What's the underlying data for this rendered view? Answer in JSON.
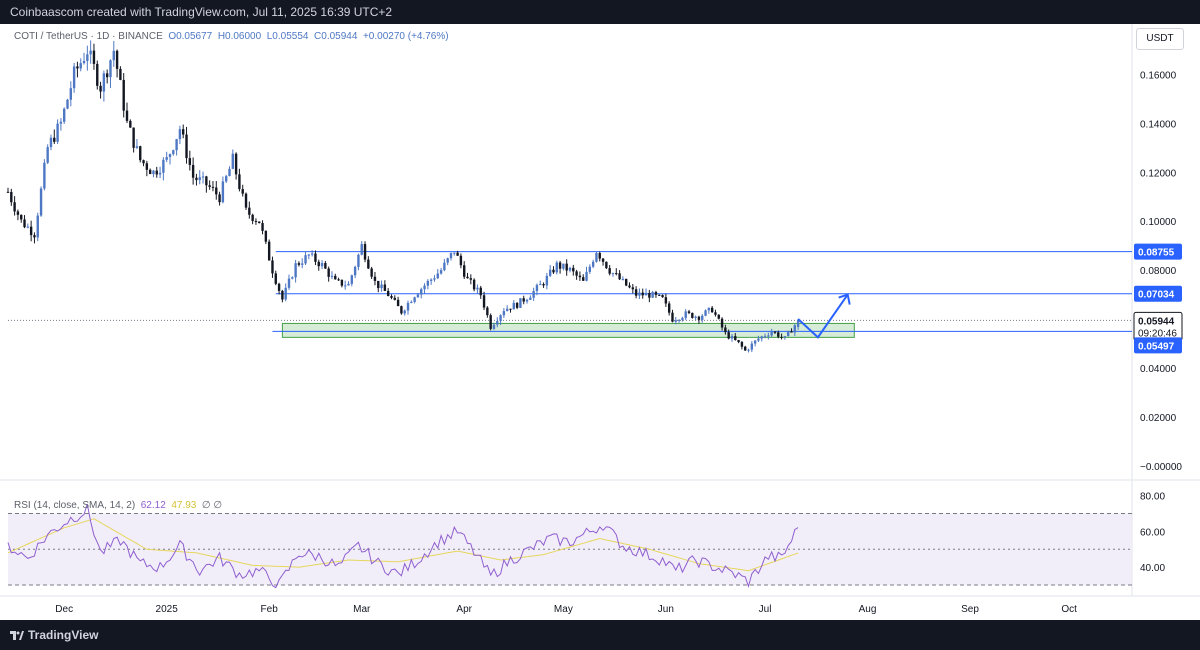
{
  "header": {
    "text": "Coinbaascom created with TradingView.com, Jul 11, 2025 16:39 UTC+2"
  },
  "legend": {
    "symbol": "COTI / TetherUS · 1D · BINANCE",
    "open": "O0.05677",
    "high": "H0.06000",
    "low": "L0.05554",
    "close": "C0.05944",
    "change": "+0.00270 (+4.76%)"
  },
  "price_axis": {
    "unit": "USDT",
    "ticks": [
      "0.16000",
      "0.14000",
      "0.12000",
      "0.10000",
      "0.08000",
      "0.04000",
      "0.02000",
      "−0.00000"
    ]
  },
  "price_labels": {
    "resistance": "0.08755",
    "target": "0.07034",
    "current": "0.05944",
    "countdown": "09:20:46",
    "support": "0.05497"
  },
  "rsi_legend": {
    "title": "RSI (14, close, SMA, 14, 2)",
    "rsi_value": "62.12",
    "ma_value": "47.93",
    "extra": "∅  ∅"
  },
  "rsi_axis": {
    "ticks": [
      "80.00",
      "60.00",
      "40.00"
    ]
  },
  "time_axis": {
    "ticks": [
      "Dec",
      "2025",
      "Feb",
      "Mar",
      "Apr",
      "May",
      "Jun",
      "Jul",
      "Aug",
      "Sep",
      "Oct"
    ]
  },
  "footer": {
    "brand": "TradingView"
  },
  "colors": {
    "bull": "#4e78c4",
    "bear": "#131722",
    "level_line": "#2962ff",
    "zone_fill": "#c8e6c9",
    "rsi_line": "#8f5fd0",
    "rsi_ma": "#e6d65c",
    "rsi_band": "#ede7f6"
  },
  "chart_data": [
    {
      "type": "candlestick",
      "symbol": "COTI / TetherUS",
      "exchange": "BINANCE",
      "ylim": [
        -0.0001,
        0.17
      ],
      "x_range": [
        "2024-11-14",
        "2025-10-20"
      ],
      "ohlc": {
        "open": 0.05677,
        "high": 0.06,
        "low": 0.05554,
        "close": 0.05944,
        "change": 0.0027,
        "change_pct": 4.76
      },
      "close_path": [
        [
          "2024-11-14",
          0.112
        ],
        [
          "2024-11-18",
          0.1
        ],
        [
          "2024-11-22",
          0.095
        ],
        [
          "2024-11-26",
          0.13
        ],
        [
          "2024-11-30",
          0.14
        ],
        [
          "2024-12-04",
          0.16
        ],
        [
          "2024-12-08",
          0.17
        ],
        [
          "2024-12-12",
          0.155
        ],
        [
          "2024-12-16",
          0.17
        ],
        [
          "2024-12-20",
          0.14
        ],
        [
          "2024-12-24",
          0.125
        ],
        [
          "2024-12-28",
          0.12
        ],
        [
          "2025-01-01",
          0.125
        ],
        [
          "2025-01-05",
          0.138
        ],
        [
          "2025-01-09",
          0.118
        ],
        [
          "2025-01-13",
          0.115
        ],
        [
          "2025-01-17",
          0.11
        ],
        [
          "2025-01-21",
          0.125
        ],
        [
          "2025-01-25",
          0.104
        ],
        [
          "2025-01-29",
          0.1
        ],
        [
          "2025-02-02",
          0.08
        ],
        [
          "2025-02-05",
          0.068
        ],
        [
          "2025-02-09",
          0.082
        ],
        [
          "2025-02-13",
          0.086
        ],
        [
          "2025-02-17",
          0.082
        ],
        [
          "2025-02-21",
          0.075
        ],
        [
          "2025-02-25",
          0.074
        ],
        [
          "2025-03-01",
          0.09
        ],
        [
          "2025-03-05",
          0.075
        ],
        [
          "2025-03-09",
          0.07
        ],
        [
          "2025-03-13",
          0.063
        ],
        [
          "2025-03-17",
          0.07
        ],
        [
          "2025-03-21",
          0.075
        ],
        [
          "2025-03-25",
          0.08
        ],
        [
          "2025-03-29",
          0.088
        ],
        [
          "2025-04-02",
          0.076
        ],
        [
          "2025-04-06",
          0.07
        ],
        [
          "2025-04-09",
          0.057
        ],
        [
          "2025-04-13",
          0.064
        ],
        [
          "2025-04-17",
          0.066
        ],
        [
          "2025-04-21",
          0.07
        ],
        [
          "2025-04-25",
          0.075
        ],
        [
          "2025-04-29",
          0.082
        ],
        [
          "2025-05-03",
          0.08
        ],
        [
          "2025-05-07",
          0.075
        ],
        [
          "2025-05-11",
          0.088
        ],
        [
          "2025-05-15",
          0.08
        ],
        [
          "2025-05-19",
          0.075
        ],
        [
          "2025-05-23",
          0.07
        ],
        [
          "2025-05-27",
          0.07
        ],
        [
          "2025-05-31",
          0.068
        ],
        [
          "2025-06-03",
          0.06
        ],
        [
          "2025-06-07",
          0.062
        ],
        [
          "2025-06-11",
          0.061
        ],
        [
          "2025-06-15",
          0.064
        ],
        [
          "2025-06-19",
          0.054
        ],
        [
          "2025-06-23",
          0.05
        ],
        [
          "2025-06-25",
          0.047
        ],
        [
          "2025-06-29",
          0.052
        ],
        [
          "2025-07-03",
          0.055
        ],
        [
          "2025-07-07",
          0.052
        ],
        [
          "2025-07-11",
          0.0594
        ]
      ],
      "horizontal_levels": [
        0.08755,
        0.07034,
        0.05497
      ],
      "current_price": 0.05944,
      "zone": {
        "from": "2025-02-05",
        "to": "2025-07-28",
        "low": 0.0525,
        "high": 0.0582
      },
      "projection": [
        [
          "2025-07-11",
          0.06
        ],
        [
          "2025-07-17",
          0.0525
        ],
        [
          "2025-07-26",
          0.07
        ]
      ]
    },
    {
      "type": "line",
      "title": "RSI (14, close, SMA, 14, 2)",
      "ylim": [
        25,
        82
      ],
      "bands": [
        70,
        50,
        30
      ],
      "series": [
        {
          "name": "RSI",
          "points": [
            [
              "2024-11-14",
              52
            ],
            [
              "2024-11-20",
              45
            ],
            [
              "2024-11-26",
              58
            ],
            [
              "2024-12-02",
              66
            ],
            [
              "2024-12-08",
              72
            ],
            [
              "2024-12-12",
              48
            ],
            [
              "2024-12-18",
              55
            ],
            [
              "2024-12-24",
              42
            ],
            [
              "2024-12-30",
              40
            ],
            [
              "2025-01-05",
              52
            ],
            [
              "2025-01-11",
              38
            ],
            [
              "2025-01-17",
              45
            ],
            [
              "2025-01-23",
              36
            ],
            [
              "2025-01-29",
              38
            ],
            [
              "2025-02-04",
              30
            ],
            [
              "2025-02-10",
              48
            ],
            [
              "2025-02-16",
              46
            ],
            [
              "2025-02-22",
              40
            ],
            [
              "2025-02-28",
              52
            ],
            [
              "2025-03-06",
              42
            ],
            [
              "2025-03-12",
              36
            ],
            [
              "2025-03-18",
              44
            ],
            [
              "2025-03-24",
              54
            ],
            [
              "2025-03-30",
              60
            ],
            [
              "2025-04-05",
              46
            ],
            [
              "2025-04-09",
              35
            ],
            [
              "2025-04-15",
              44
            ],
            [
              "2025-04-21",
              50
            ],
            [
              "2025-04-27",
              56
            ],
            [
              "2025-05-03",
              54
            ],
            [
              "2025-05-09",
              60
            ],
            [
              "2025-05-13",
              64
            ],
            [
              "2025-05-19",
              52
            ],
            [
              "2025-05-25",
              48
            ],
            [
              "2025-05-31",
              44
            ],
            [
              "2025-06-04",
              38
            ],
            [
              "2025-06-10",
              44
            ],
            [
              "2025-06-16",
              40
            ],
            [
              "2025-06-22",
              36
            ],
            [
              "2025-06-26",
              32
            ],
            [
              "2025-07-02",
              46
            ],
            [
              "2025-07-06",
              45
            ],
            [
              "2025-07-11",
              62.12
            ]
          ]
        },
        {
          "name": "RSI-based MA",
          "points": [
            [
              "2024-11-14",
              48
            ],
            [
              "2024-12-01",
              62
            ],
            [
              "2024-12-10",
              67
            ],
            [
              "2024-12-26",
              50
            ],
            [
              "2025-01-10",
              48
            ],
            [
              "2025-01-27",
              41
            ],
            [
              "2025-02-10",
              40
            ],
            [
              "2025-02-25",
              44
            ],
            [
              "2025-03-12",
              43
            ],
            [
              "2025-03-30",
              49
            ],
            [
              "2025-04-12",
              44
            ],
            [
              "2025-04-25",
              47
            ],
            [
              "2025-05-12",
              56
            ],
            [
              "2025-05-27",
              50
            ],
            [
              "2025-06-11",
              42
            ],
            [
              "2025-06-26",
              38
            ],
            [
              "2025-07-11",
              47.93
            ]
          ]
        }
      ]
    }
  ]
}
